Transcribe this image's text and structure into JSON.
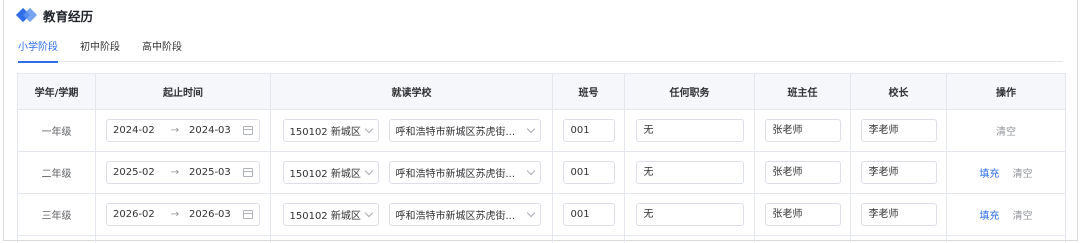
{
  "section": {
    "title": "教育经历",
    "logo_icon": "diamond-logo-icon",
    "accent_color": "#2f6ee8"
  },
  "tabs": [
    {
      "label": "小学阶段",
      "active": true
    },
    {
      "label": "初中阶段",
      "active": false
    },
    {
      "label": "高中阶段",
      "active": false
    }
  ],
  "table": {
    "headers": [
      "学年/学期",
      "起止时间",
      "就读学校",
      "班号",
      "任何职务",
      "班主任",
      "校长",
      "操作"
    ],
    "range_separator": "→",
    "rows": [
      {
        "grade": "一年级",
        "start": "2024-02",
        "end": "2024-03",
        "district": "150102 新城区",
        "school": "呼和浩特市新城区苏虎街...",
        "class_no": "001",
        "duty": "无",
        "head_teacher": "张老师",
        "principal": "李老师",
        "fill": "",
        "clear": "清空"
      },
      {
        "grade": "二年级",
        "start": "2025-02",
        "end": "2025-03",
        "district": "150102 新城区",
        "school": "呼和浩特市新城区苏虎街...",
        "class_no": "001",
        "duty": "无",
        "head_teacher": "张老师",
        "principal": "李老师",
        "fill": "填充",
        "clear": "清空"
      },
      {
        "grade": "三年级",
        "start": "2026-02",
        "end": "2026-03",
        "district": "150102 新城区",
        "school": "呼和浩特市新城区苏虎街...",
        "class_no": "001",
        "duty": "无",
        "head_teacher": "张老师",
        "principal": "李老师",
        "fill": "填充",
        "clear": "清空"
      }
    ]
  }
}
